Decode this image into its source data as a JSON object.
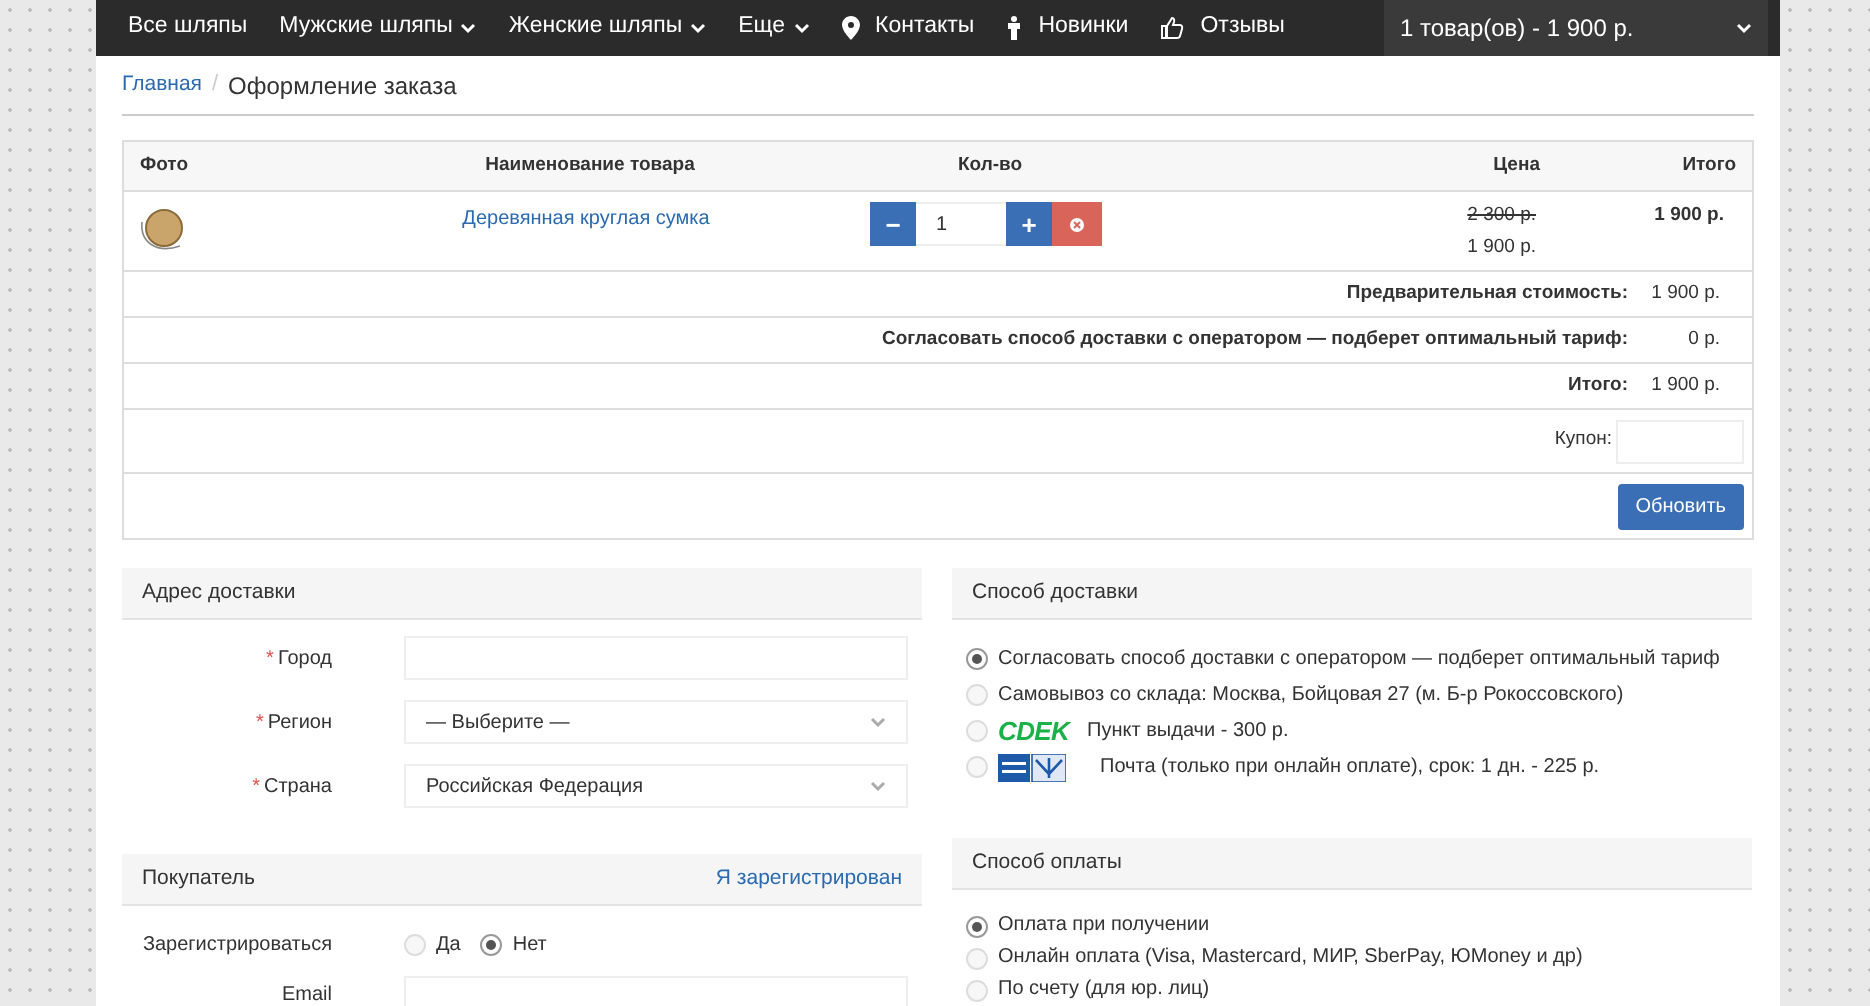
{
  "nav": {
    "items": [
      {
        "label": "Все шляпы",
        "kind": "plain"
      },
      {
        "label": "Мужские шляпы",
        "kind": "dropdown"
      },
      {
        "label": "Женские шляпы",
        "kind": "dropdown"
      },
      {
        "label": "Еще",
        "kind": "dropdown"
      },
      {
        "label": "Контакты",
        "kind": "pin"
      },
      {
        "label": "Новинки",
        "kind": "figure"
      },
      {
        "label": "Отзывы",
        "kind": "thumb"
      }
    ],
    "cart": "1 товар(ов) - 1 900 р."
  },
  "breadcrumb": [
    {
      "label": "Главная",
      "kind": "link"
    },
    {
      "separator": "/",
      "label": "Оформление заказа",
      "kind": "current"
    }
  ],
  "cart_table": {
    "columns": [
      "Фото",
      "Наименование товара",
      "Кол-во",
      "Цена",
      "Итого"
    ],
    "product": {
      "name": "Деревянная круглая сумка",
      "quantity": "1",
      "minus": "−",
      "plus": "+",
      "old_price": "2 300 р.",
      "price": "1 900 р.",
      "total": "1 900 р."
    },
    "summary": [
      {
        "label": "Предварительная стоимость:",
        "value": "1 900 р."
      },
      {
        "label": "Согласовать способ доставки с оператором — подберет оптимальный тариф:",
        "value": "0 р."
      },
      {
        "label": "Итого:",
        "value": "1 900 р."
      }
    ],
    "coupon_label": "Купон:",
    "update_button": "Обновить"
  },
  "address": {
    "title": "Адрес доставки",
    "fields": [
      {
        "label": "Город",
        "kind": "input",
        "required_mark": "*"
      },
      {
        "label": "Регион",
        "kind": "select",
        "value": "— Выберите —",
        "required_mark": "*"
      },
      {
        "label": "Страна",
        "kind": "select",
        "value": "Российская Федерация",
        "required_mark": "*"
      }
    ]
  },
  "buyer": {
    "title": "Покупатель",
    "login_link": "Я зарегистрирован",
    "register_label": "Зарегистрироваться",
    "register_options": [
      {
        "label": "Да",
        "selected": false
      },
      {
        "label": "Нет",
        "selected": true
      }
    ],
    "email_label": "Email"
  },
  "delivery": {
    "title": "Способ доставки",
    "options": [
      {
        "label": "Согласовать способ доставки с оператором — подберет оптимальный тариф",
        "kind": "plain",
        "selected": true
      },
      {
        "label": "Самовывоз со склада: Москва, Бойцовая 27 (м. Б-р Рокоссовского)",
        "kind": "plain",
        "selected": false
      },
      {
        "label": "Пункт выдачи - 300 р.",
        "kind": "cdek",
        "logo": "CDEK",
        "selected": false
      },
      {
        "label": "Почта (только при онлайн оплате), срок: 1 дн. - 225 р.",
        "kind": "post",
        "selected": false
      }
    ]
  },
  "payment": {
    "title": "Способ оплаты",
    "options": [
      {
        "label": "Оплата при получении",
        "selected": true
      },
      {
        "label": "Онлайн оплата (Visa, Mastercard, МИР, SberPay, ЮMoney и др)",
        "selected": false
      },
      {
        "label": "По счету (для юр. лиц)",
        "selected": false
      }
    ]
  }
}
